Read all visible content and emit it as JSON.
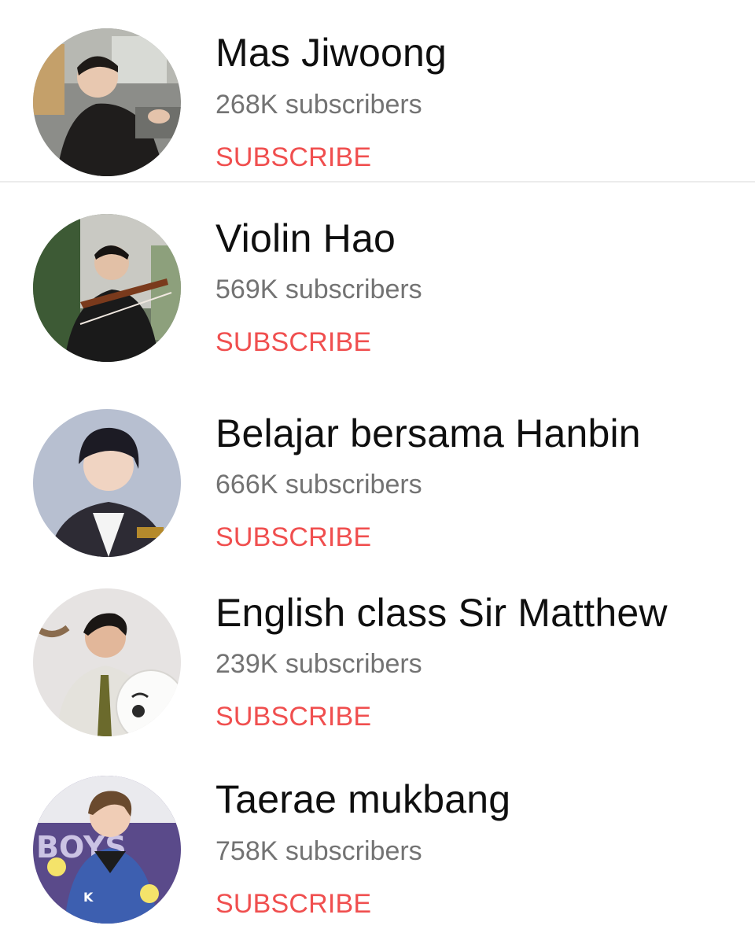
{
  "channels": [
    {
      "name": "Mas Jiwoong",
      "subscribers": "268K subscribers",
      "action": "SUBSCRIBE"
    },
    {
      "name": "Violin Hao",
      "subscribers": "569K subscribers",
      "action": "SUBSCRIBE"
    },
    {
      "name": "Belajar bersama Hanbin",
      "subscribers": "666K subscribers",
      "action": "SUBSCRIBE"
    },
    {
      "name": "English class Sir Matthew",
      "subscribers": "239K subscribers",
      "action": "SUBSCRIBE"
    },
    {
      "name": "Taerae mukbang",
      "subscribers": "758K subscribers",
      "action": "SUBSCRIBE"
    }
  ],
  "colors": {
    "subscribe": "#f04f4f",
    "name": "#0f0f0f",
    "subscribers": "#737373"
  }
}
